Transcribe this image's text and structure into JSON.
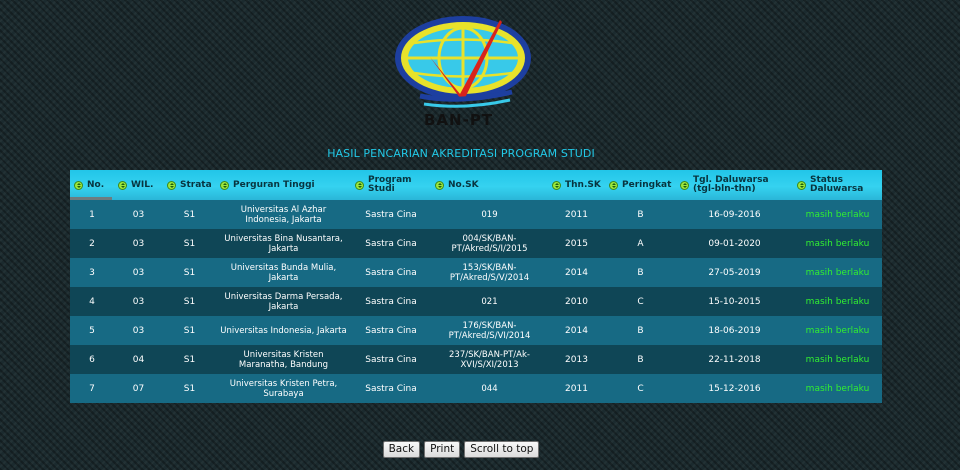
{
  "logo": {
    "text": "BAN-PT"
  },
  "page_title": "HASIL PENCARIAN AKREDITASI PROGRAM STUDI",
  "table": {
    "headers": [
      "No.",
      "WIL.",
      "Strata",
      "Perguran Tinggi",
      "Program Studi",
      "No.SK",
      "Thn.SK",
      "Peringkat",
      "Tgl. Daluwarsa (tgl-bln-thn)",
      "Status Daluwarsa"
    ],
    "rows": [
      [
        "1",
        "03",
        "S1",
        "Universitas Al Azhar Indonesia, Jakarta",
        "Sastra Cina",
        "019",
        "2011",
        "B",
        "16-09-2016",
        "masih berlaku"
      ],
      [
        "2",
        "03",
        "S1",
        "Universitas Bina Nusantara, Jakarta",
        "Sastra Cina",
        "004/SK/BAN-PT/Akred/S/I/2015",
        "2015",
        "A",
        "09-01-2020",
        "masih berlaku"
      ],
      [
        "3",
        "03",
        "S1",
        "Universitas Bunda Mulia, Jakarta",
        "Sastra Cina",
        "153/SK/BAN-PT/Akred/S/V/2014",
        "2014",
        "B",
        "27-05-2019",
        "masih berlaku"
      ],
      [
        "4",
        "03",
        "S1",
        "Universitas Darma Persada, Jakarta",
        "Sastra Cina",
        "021",
        "2010",
        "C",
        "15-10-2015",
        "masih berlaku"
      ],
      [
        "5",
        "03",
        "S1",
        "Universitas Indonesia, Jakarta",
        "Sastra Cina",
        "176/SK/BAN-PT/Akred/S/VI/2014",
        "2014",
        "B",
        "18-06-2019",
        "masih berlaku"
      ],
      [
        "6",
        "04",
        "S1",
        "Universitas Kristen Maranatha, Bandung",
        "Sastra Cina",
        "237/SK/BAN-PT/Ak-XVI/S/XI/2013",
        "2013",
        "B",
        "22-11-2018",
        "masih berlaku"
      ],
      [
        "7",
        "07",
        "S1",
        "Universitas Kristen Petra, Surabaya",
        "Sastra Cina",
        "044",
        "2011",
        "C",
        "15-12-2016",
        "masih berlaku"
      ]
    ]
  },
  "buttons": {
    "back": "Back",
    "print": "Print",
    "scroll_top": "Scroll to top"
  },
  "colors": {
    "header": "#2cc8ea",
    "row_odd": "#176a84",
    "row_even": "#0f4656",
    "status": "#31ef31",
    "title": "#22c8e6"
  }
}
